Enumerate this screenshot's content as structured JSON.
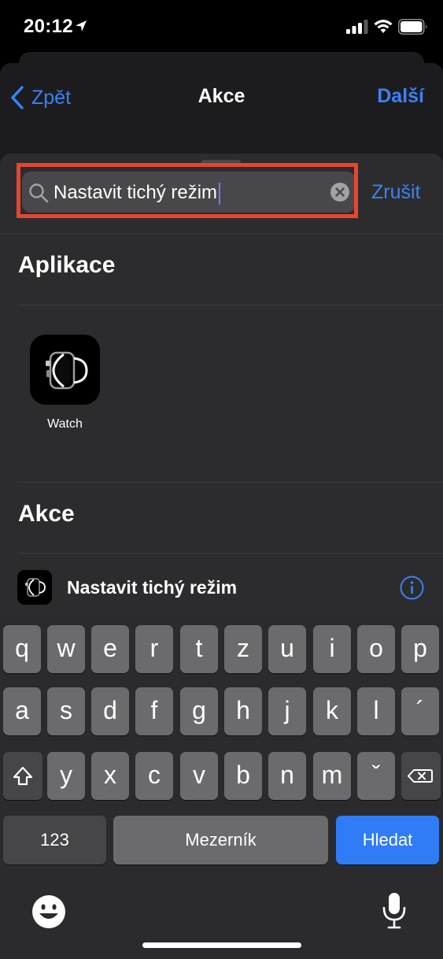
{
  "status_bar": {
    "time": "20:12"
  },
  "nav": {
    "back_label": "Zpět",
    "title": "Akce",
    "next_label": "Další"
  },
  "search": {
    "value": "Nastavit tichý režim",
    "cancel_label": "Zrušit"
  },
  "sections": {
    "apps_title": "Aplikace",
    "actions_title": "Akce"
  },
  "apps": [
    {
      "label": "Watch",
      "icon": "watch-icon"
    }
  ],
  "actions": [
    {
      "label": "Nastavit tichý režim",
      "icon": "watch-icon"
    }
  ],
  "keyboard": {
    "row1": [
      "q",
      "w",
      "e",
      "r",
      "t",
      "z",
      "u",
      "i",
      "o",
      "p"
    ],
    "row2": [
      "a",
      "s",
      "d",
      "f",
      "g",
      "h",
      "j",
      "k",
      "l",
      "´"
    ],
    "row3": [
      "y",
      "x",
      "c",
      "v",
      "b",
      "n",
      "m",
      "ˇ"
    ],
    "numbers_label": "123",
    "space_label": "Mezerník",
    "search_label": "Hledat"
  },
  "colors": {
    "accent": "#3a82f6",
    "highlight": "#e8452f",
    "search_key": "#2f7cf6"
  }
}
